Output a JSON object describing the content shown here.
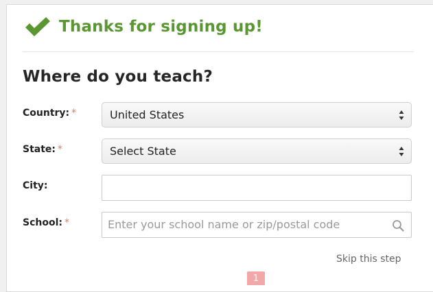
{
  "header": {
    "title": "Thanks for signing up!",
    "icon": "checkmark-icon",
    "color": "#5a9632"
  },
  "form": {
    "heading": "Where do you teach?",
    "required_marker": "*",
    "required_color": "#e07a5f",
    "country": {
      "label": "Country:",
      "value": "United States"
    },
    "state": {
      "label": "State:",
      "value": "Select State"
    },
    "city": {
      "label": "City:",
      "value": ""
    },
    "school": {
      "label": "School:",
      "placeholder": "Enter your school name or zip/postal code",
      "icon": "search-icon"
    }
  },
  "skip_label": "Skip this step",
  "badge": "1"
}
